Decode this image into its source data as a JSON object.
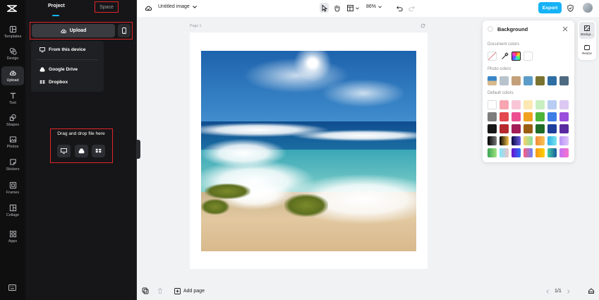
{
  "sidebar": {
    "items": [
      {
        "label": "Templates",
        "icon": "templates-icon"
      },
      {
        "label": "Design",
        "icon": "design-icon"
      },
      {
        "label": "Upload",
        "icon": "upload-icon",
        "active": true
      },
      {
        "label": "Text",
        "icon": "text-icon"
      },
      {
        "label": "Shapes",
        "icon": "shapes-icon"
      },
      {
        "label": "Photos",
        "icon": "photos-icon"
      },
      {
        "label": "Stickers",
        "icon": "stickers-icon"
      },
      {
        "label": "Frames",
        "icon": "frames-icon"
      },
      {
        "label": "Collage",
        "icon": "collage-icon"
      },
      {
        "label": "Apps",
        "icon": "apps-icon"
      }
    ]
  },
  "panel": {
    "tabs": {
      "project": "Project",
      "space": "Space"
    },
    "upload_label": "Upload",
    "menu": {
      "from_device": "From this device",
      "google_drive": "Google Drive",
      "dropbox": "Dropbox"
    },
    "drop_text": "Drag and drop file here"
  },
  "toolbar": {
    "title": "Untitled image",
    "zoom": "86%",
    "export_label": "Export"
  },
  "canvas": {
    "page_label": "Page 1"
  },
  "background_panel": {
    "title": "Background",
    "document_colors_label": "Document colors",
    "photo_colors_label": "Photo colors",
    "default_colors_label": "Default colors",
    "photo_colors": [
      "#b8c3cc",
      "#c4a07a",
      "#5c9cc9",
      "#7a7330",
      "#2f6ea3",
      "#4d6a80"
    ],
    "default_colors": [
      [
        "#ffffff",
        "#f7a6b1",
        "#f9c6d7",
        "#fce8b2",
        "#c9eec0",
        "#b8cdf3",
        "#dcc8f3"
      ],
      [
        "#7d7d7d",
        "#e2484e",
        "#ec4f91",
        "#f0a21f",
        "#4cb53a",
        "#3d7ee6",
        "#9a4fdc"
      ],
      [
        "#161616",
        "#b52a2f",
        "#a31d58",
        "#9a5e12",
        "#1f6b28",
        "#1d3f9a",
        "#5a2aa0"
      ]
    ],
    "gradient_rows": [
      [
        "#000000|#7a7a7a",
        "#000000|#f5c24a",
        "#0b0b40|#6c5ce7",
        "#f5d26a|#88e0a1",
        "#f28b3a|#f6c453",
        "#2bb1e8|#7be3f0",
        "#b794f6|#e0c3fc"
      ],
      [
        "#3aa655|#a4e27f",
        "#7ee8fa|#eec0c6",
        "#6a11cb|#2575fc",
        "#fc5c7d|#6a82fb",
        "#f7971e|#ffd200",
        "#43cea2|#185a9d",
        "#c471f5|#fa71cd"
      ]
    ]
  },
  "side_rail": {
    "background_label": "Backgr...",
    "resize_label": "Resize"
  },
  "bottombar": {
    "add_page": "Add page",
    "page_count": "1/1"
  }
}
